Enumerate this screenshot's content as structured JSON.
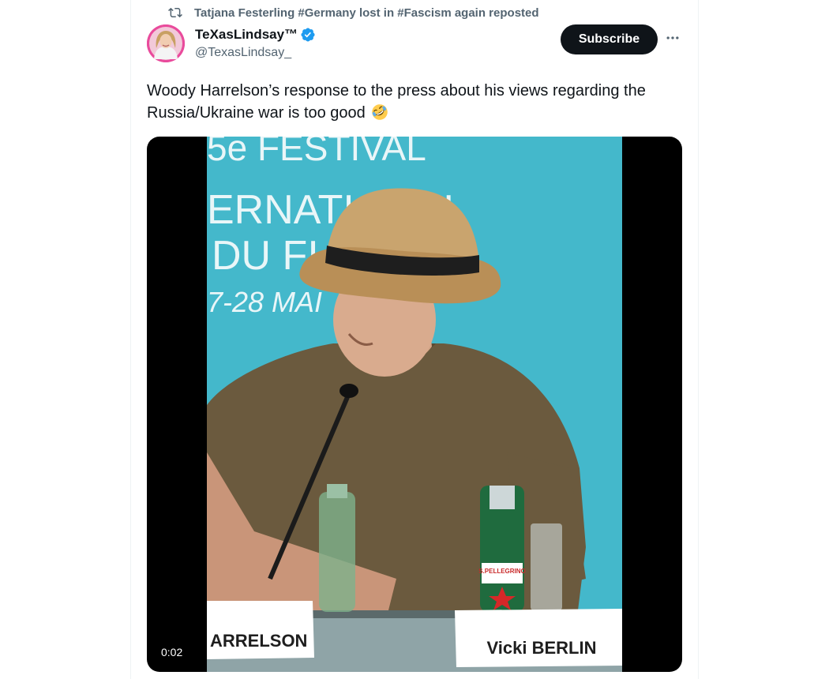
{
  "repost": {
    "text": "Tatjana Festerling #Germany lost in #Fascism again reposted",
    "icon": "repost-icon"
  },
  "author": {
    "display_name": "TeXasLindsay™",
    "handle": "@TexasLindsay_",
    "verified": true,
    "avatar_icon": "avatar"
  },
  "actions": {
    "subscribe_label": "Subscribe",
    "more_icon": "more-icon"
  },
  "tweet": {
    "text": "Woody Harrelson’s response to the press about his views regarding the Russia/Ukraine war is too good",
    "emoji": "rolling-on-floor-laughing"
  },
  "video": {
    "timestamp": "0:02",
    "backdrop_lines": [
      "5e FESTIVAL",
      "ERNATIONAL",
      "DU FI",
      "7-28 MAI"
    ],
    "name_card_left": "ARRELSON",
    "name_card_right": "Vicki BERLIN",
    "bottle_label": "S.PELLEGRINO",
    "colors": {
      "backdrop": "#3fb4c8",
      "hat": "#c9a46e",
      "hat_band": "#1e1e1e",
      "shirt": "#6b5a3e"
    }
  },
  "theme": {
    "text_primary": "#0f1419",
    "text_secondary": "#536471",
    "verified_blue": "#1d9bf0"
  }
}
